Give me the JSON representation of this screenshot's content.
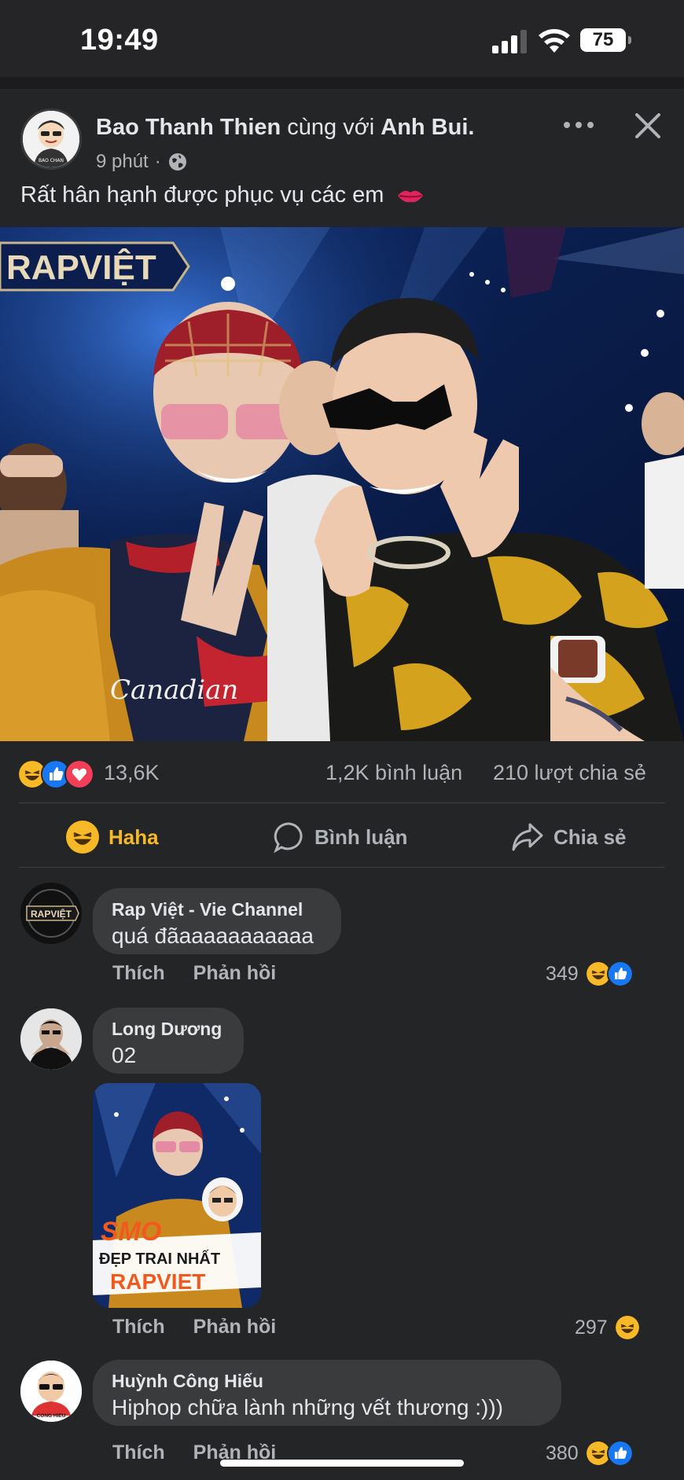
{
  "status_bar": {
    "time": "19:49",
    "battery": "75"
  },
  "post": {
    "author": "Bao Thanh Thien",
    "with_text": "cùng với",
    "tagged": "Anh Bui.",
    "time": "9 phút",
    "caption": "Rất hân hạnh được phục vụ các em",
    "caption_emoji": "lips-emoji",
    "photo_sign_text": "RAPVIỆT",
    "author_avatar_text": "BAO CHAN"
  },
  "stats": {
    "reactions": [
      "haha",
      "like",
      "love"
    ],
    "reaction_count": "13,6K",
    "comments": "1,2K bình luận",
    "shares": "210 lượt chia sẻ"
  },
  "actions": {
    "haha": "Haha",
    "comment": "Bình luận",
    "share": "Chia sẻ"
  },
  "comments": [
    {
      "name": "Rap Việt - Vie Channel",
      "text": "quá đãaaaaaaaaaaa",
      "like": "Thích",
      "reply": "Phản hồi",
      "count": "349",
      "reactions": [
        "haha",
        "like"
      ],
      "avatar_text": "RAPVIỆT"
    },
    {
      "name": "Long Dương",
      "text": "02",
      "like": "Thích",
      "reply": "Phản hồi",
      "count": "297",
      "reactions": [
        "haha"
      ],
      "sticker": {
        "line1": "SMO",
        "line2": "ĐẸP TRAI NHẤT",
        "line3": "RAPVIET"
      }
    },
    {
      "name": "Huỳnh Công Hiếu",
      "text": "Hiphop chữa lành những vết thương :)))",
      "like": "Thích",
      "reply": "Phản hồi",
      "count": "380",
      "reactions": [
        "haha",
        "like"
      ],
      "avatar_text": "CONG HIEU"
    }
  ],
  "colors": {
    "background": "#242526",
    "bubble": "#3a3b3c",
    "haha": "#f7b928",
    "like": "#1877f2",
    "love": "#f33e58"
  }
}
